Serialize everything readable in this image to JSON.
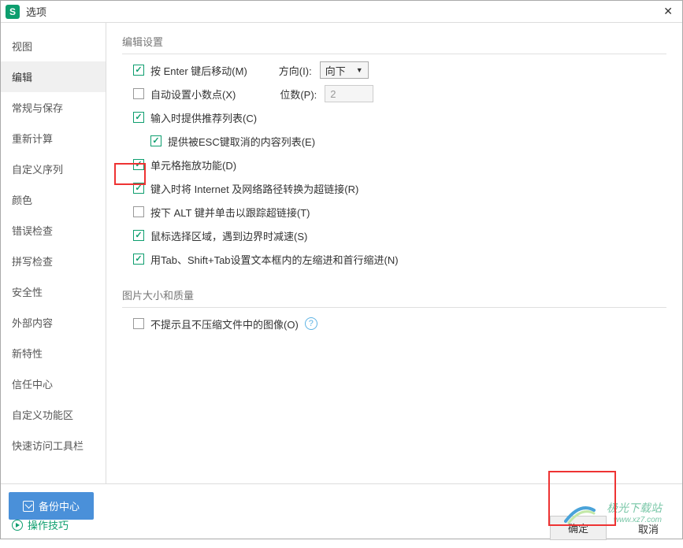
{
  "title": "选项",
  "close_label": "✕",
  "sidebar": {
    "items": [
      {
        "label": "视图"
      },
      {
        "label": "编辑"
      },
      {
        "label": "常规与保存"
      },
      {
        "label": "重新计算"
      },
      {
        "label": "自定义序列"
      },
      {
        "label": "颜色"
      },
      {
        "label": "错误检查"
      },
      {
        "label": "拼写检查"
      },
      {
        "label": "安全性"
      },
      {
        "label": "外部内容"
      },
      {
        "label": "新特性"
      },
      {
        "label": "信任中心"
      },
      {
        "label": "自定义功能区"
      },
      {
        "label": "快速访问工具栏"
      }
    ],
    "active_index": 1
  },
  "sections": {
    "edit": {
      "title": "编辑设置",
      "enter_move": "按 Enter 键后移动(M)",
      "direction_label": "方向(I):",
      "direction_value": "向下",
      "auto_decimal": "自动设置小数点(X)",
      "digits_label": "位数(P):",
      "digits_value": "2",
      "input_recommend": "输入时提供推荐列表(C)",
      "esc_cancel": "提供被ESC键取消的内容列表(E)",
      "cell_drag": "单元格拖放功能(D)",
      "internet_link": "键入时将 Internet 及网络路径转换为超链接(R)",
      "alt_click": "按下 ALT 键并单击以跟踪超链接(T)",
      "mouse_select": "鼠标选择区域，遇到边界时减速(S)",
      "tab_indent": "用Tab、Shift+Tab设置文本框内的左缩进和首行缩进(N)"
    },
    "image": {
      "title": "图片大小和质量",
      "no_compress": "不提示且不压缩文件中的图像(O)"
    }
  },
  "footer": {
    "backup": "备份中心",
    "tips": "操作技巧",
    "ok": "确定",
    "cancel": "取消"
  },
  "watermark": {
    "main": "极光下载站",
    "sub": "www.xz7.com"
  }
}
